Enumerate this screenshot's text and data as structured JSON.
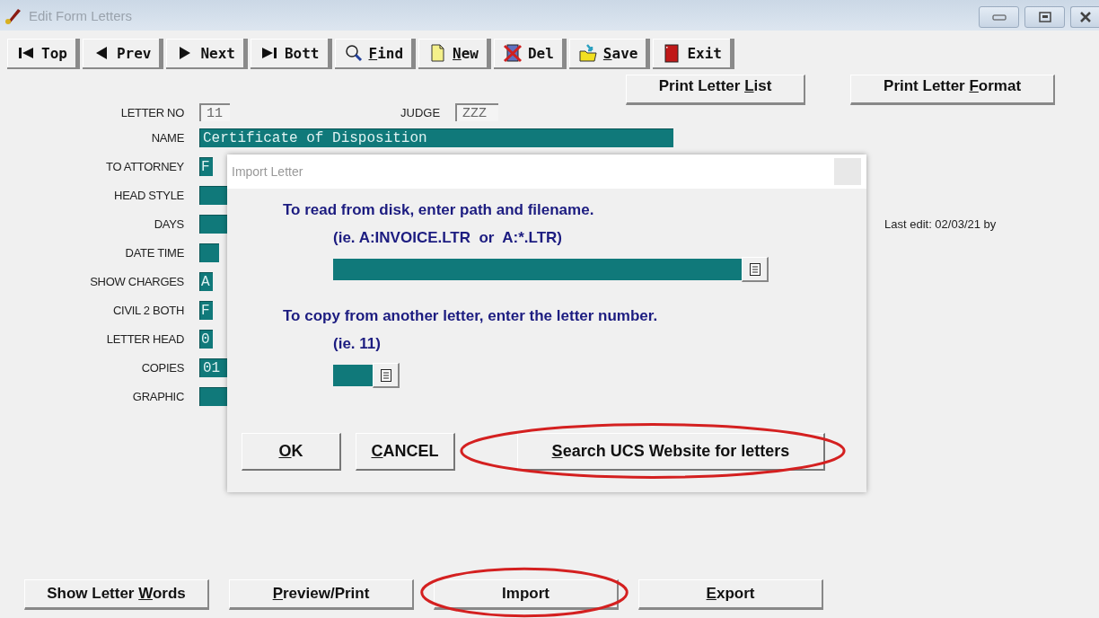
{
  "window": {
    "title": "Edit Form Letters"
  },
  "toolbar": [
    {
      "label_parts": [
        {
          "text": "Top",
          "underlined": false
        }
      ]
    },
    {
      "label_parts": [
        {
          "text": "Prev",
          "underlined": false
        }
      ]
    },
    {
      "label_parts": [
        {
          "text": "Next",
          "underlined": false
        }
      ]
    },
    {
      "label_parts": [
        {
          "text": "Bott",
          "underlined": false
        }
      ]
    },
    {
      "label_parts": [
        {
          "text": "F",
          "underlined": true
        },
        {
          "text": "ind",
          "underlined": false
        }
      ]
    },
    {
      "label_parts": [
        {
          "text": "N",
          "underlined": true
        },
        {
          "text": "ew",
          "underlined": false
        }
      ]
    },
    {
      "label_parts": [
        {
          "text": "Del",
          "underlined": false
        }
      ]
    },
    {
      "label_parts": [
        {
          "text": "S",
          "underlined": true
        },
        {
          "text": "ave",
          "underlined": false
        }
      ]
    },
    {
      "label_parts": [
        {
          "text": "Exit",
          "underlined": false
        }
      ]
    }
  ],
  "record": {
    "letter_no": {
      "label": "LETTER NO",
      "value": "11"
    },
    "judge": {
      "label": "JUDGE",
      "value": "ZZZ"
    }
  },
  "print_buttons": [
    {
      "label_parts": [
        {
          "text": "Print Letter ",
          "underlined": false
        },
        {
          "text": "L",
          "underlined": true
        },
        {
          "text": "ist",
          "underlined": false
        }
      ]
    },
    {
      "label_parts": [
        {
          "text": "Print Letter ",
          "underlined": false
        },
        {
          "text": "F",
          "underlined": true
        },
        {
          "text": "ormat",
          "underlined": false
        }
      ]
    }
  ],
  "fields": [
    {
      "label": "NAME",
      "value": "Certificate of Disposition",
      "kind": "long"
    },
    {
      "label": "TO ATTORNEY",
      "value": "F",
      "kind": "one"
    },
    {
      "label": "HEAD STYLE",
      "kind": "wide"
    },
    {
      "label": "DAYS",
      "kind": "wide"
    },
    {
      "label": "DATE TIME",
      "kind": "two"
    },
    {
      "label": "SHOW CHARGES",
      "value": "A",
      "kind": "one"
    },
    {
      "label": "CIVIL 2 BOTH",
      "value": "F",
      "kind": "one"
    },
    {
      "label": "LETTER HEAD",
      "value": "0",
      "kind": "one"
    },
    {
      "label": "COPIES",
      "value": "01",
      "kind": "wide"
    },
    {
      "label": "GRAPHIC",
      "kind": "wide"
    }
  ],
  "last_edit": "Last edit: 02/03/21 by",
  "dialog": {
    "title": "Import Letter",
    "disk_prompt": "To read from disk, enter path and filename.",
    "disk_hint": "(ie. A:INVOICE.LTR  or  A:*.LTR)",
    "copy_prompt": "To copy from another letter, enter the letter number.",
    "copy_hint": "(ie. 11)",
    "buttons": [
      {
        "kind": "small",
        "highlighted": false,
        "label_parts": [
          {
            "text": "O",
            "underlined": true
          },
          {
            "text": "K",
            "underlined": false
          }
        ]
      },
      {
        "kind": "small",
        "highlighted": false,
        "label_parts": [
          {
            "text": "C",
            "underlined": true
          },
          {
            "text": "ANCEL",
            "underlined": false
          }
        ]
      },
      {
        "kind": "wide",
        "highlighted": true,
        "label_parts": [
          {
            "text": "S",
            "underlined": true
          },
          {
            "text": "earch UCS Website for letters",
            "underlined": false
          }
        ]
      }
    ]
  },
  "bottom_buttons": [
    {
      "highlighted": false,
      "label_parts": [
        {
          "text": "Show Letter ",
          "underlined": false
        },
        {
          "text": "W",
          "underlined": true
        },
        {
          "text": "ords",
          "underlined": false
        }
      ]
    },
    {
      "highlighted": false,
      "label_parts": [
        {
          "text": "P",
          "underlined": true
        },
        {
          "text": "review/Print",
          "underlined": false
        }
      ]
    },
    {
      "highlighted": true,
      "label_parts": [
        {
          "text": "Import",
          "underlined": false
        }
      ]
    },
    {
      "highlighted": false,
      "label_parts": [
        {
          "text": "E",
          "underlined": true
        },
        {
          "text": "xport",
          "underlined": false
        }
      ]
    }
  ]
}
